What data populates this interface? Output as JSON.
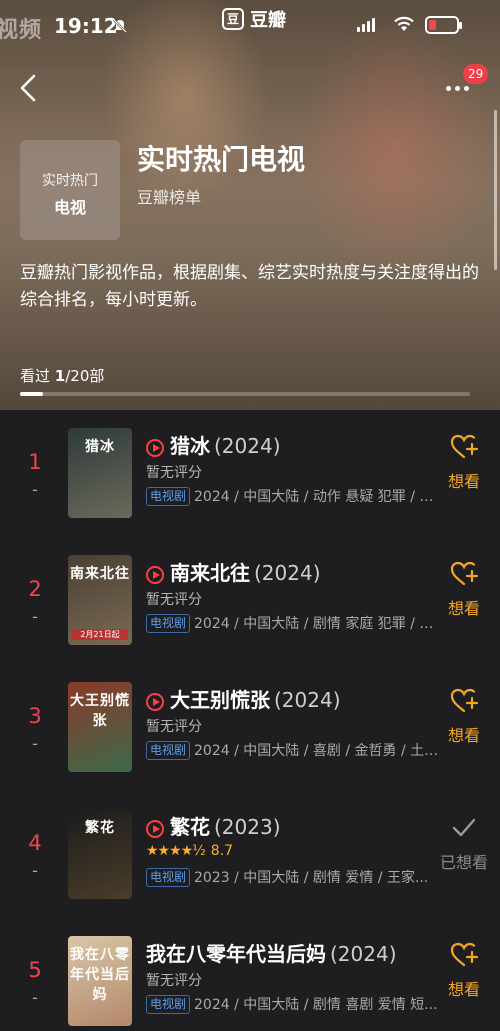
{
  "status_bar": {
    "watermark": "视频",
    "time": "19:12",
    "battery_level": 0.25,
    "battery_color": "#f04a4a"
  },
  "brand": {
    "logo": "豆",
    "name": "豆瓣"
  },
  "header": {
    "notification_count": "29",
    "cover_line1": "实时热门",
    "cover_line2": "电视",
    "title": "实时热门电视",
    "subtitle": "豆瓣榜单",
    "description": "豆瓣热门影视作品，根据剧集、综艺实时热度与关注度得出的综合排名，每小时更新。",
    "seen_label": "看过",
    "seen_count": "1",
    "seen_total": "/20部",
    "seen_progress": 0.05
  },
  "colors": {
    "accent": "#f0454e",
    "want": "#f5a623",
    "star": "#ffae2b",
    "tag": "#5f9be8"
  },
  "items": [
    {
      "rank": "1",
      "change": "-",
      "title": "猎冰",
      "year": "(2024)",
      "play": true,
      "rating_text": "暂无评分",
      "stars": "",
      "score": "",
      "tag": "电视剧",
      "meta": "2024 / 中国大陆 / 动作 悬疑 犯罪 / 高...",
      "action": "想看",
      "action_done": false,
      "poster_colors": [
        "#2e3a3a",
        "#6b6a5a"
      ],
      "poster_title": "猎冰",
      "poster_sub": ""
    },
    {
      "rank": "2",
      "change": "-",
      "title": "南来北往",
      "year": "(2024)",
      "play": true,
      "rating_text": "暂无评分",
      "stars": "",
      "score": "",
      "tag": "电视剧",
      "meta": "2024 / 中国大陆 / 剧情 家庭 犯罪 / 郑...",
      "action": "想看",
      "action_done": false,
      "poster_colors": [
        "#4a3f33",
        "#7a6a55"
      ],
      "poster_title": "南来北往",
      "poster_sub": "2月21日起"
    },
    {
      "rank": "3",
      "change": "-",
      "title": "大王别慌张",
      "year": "(2024)",
      "play": true,
      "rating_text": "暂无评分",
      "stars": "",
      "score": "",
      "tag": "电视剧",
      "meta": "2024 / 中国大陆 / 喜剧 / 金哲勇 / 土豆...",
      "action": "想看",
      "action_done": false,
      "poster_colors": [
        "#8a3a2a",
        "#3c6a4a"
      ],
      "poster_title": "大王别慌张",
      "poster_sub": ""
    },
    {
      "rank": "4",
      "change": "-",
      "title": "繁花",
      "year": "(2023)",
      "play": true,
      "rating_text": "",
      "stars": "★★★★½",
      "score": "8.7",
      "tag": "电视剧",
      "meta": "2023 / 中国大陆 / 剧情 爱情 / 王家...",
      "action": "已想看",
      "action_done": true,
      "poster_colors": [
        "#1c1c1c",
        "#4a3d2a"
      ],
      "poster_title": "繁花",
      "poster_sub": ""
    },
    {
      "rank": "5",
      "change": "-",
      "title": "我在八零年代当后妈",
      "year": "(2024)",
      "play": false,
      "rating_text": "暂无评分",
      "stars": "",
      "score": "",
      "tag": "电视剧",
      "meta": "2024 / 中国大陆 / 剧情 喜剧 爱情 短...",
      "action": "想看",
      "action_done": false,
      "poster_colors": [
        "#d7c6a8",
        "#b5886a"
      ],
      "poster_title": "我在八零年代当后妈",
      "poster_sub": ""
    }
  ]
}
